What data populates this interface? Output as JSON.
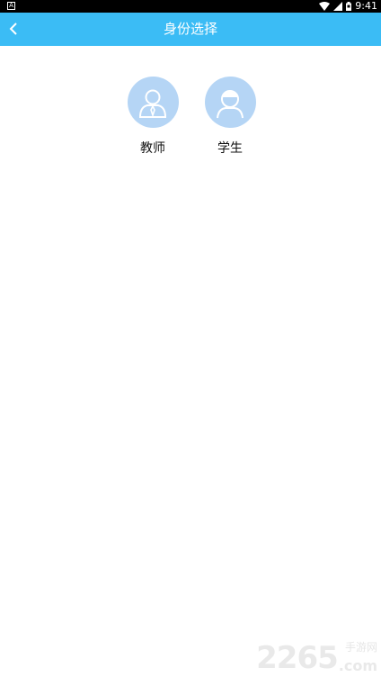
{
  "status_bar": {
    "time": "9:41",
    "icons": [
      "notification-icon",
      "wifi-icon",
      "signal-icon",
      "battery-icon"
    ]
  },
  "header": {
    "title": "身份选择",
    "back_icon": "chevron-left-icon",
    "background": "#3bbcf5"
  },
  "roles": [
    {
      "label": "教师",
      "icon": "teacher-avatar-icon"
    },
    {
      "label": "学生",
      "icon": "student-avatar-icon"
    }
  ],
  "watermark": {
    "number": "2265",
    "suffix": ".com",
    "text": "手游网"
  }
}
